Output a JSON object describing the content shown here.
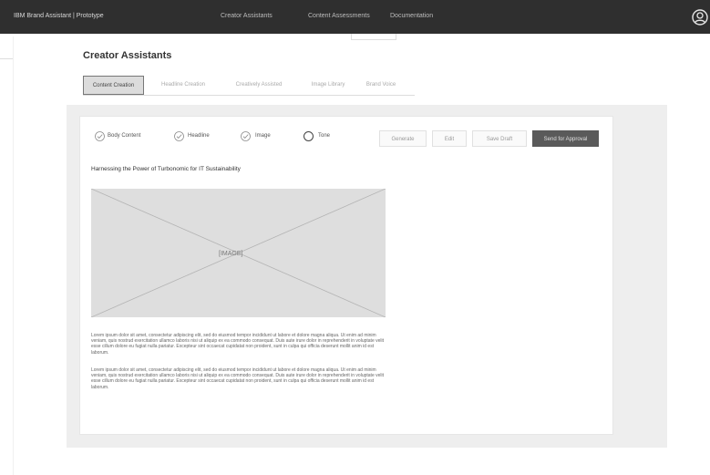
{
  "topbar": {
    "brand": "IBM Brand Assistant  |  Prototype",
    "nav": [
      "Creator Assistants",
      "Content Assessments",
      "Documentation"
    ]
  },
  "page_title": "Creator Assistants",
  "tabs": [
    "Content Creation",
    "Headline Creation",
    "Creatively Assisted",
    "Image Library",
    "Brand Voice"
  ],
  "toolbar": {
    "options": [
      "Body Content",
      "Headline",
      "Image",
      "Tone"
    ],
    "buttons": [
      "Generate",
      "Edit",
      "Save Draft",
      "Send for Approval"
    ]
  },
  "article": {
    "title": "Harnessing the Power of Turbonomic for IT Sustainability",
    "image_label": "[IMAGE]",
    "paragraphs": [
      "Lorem ipsum dolor sit amet, consectetur adipiscing elit, sed do eiusmod tempor incididunt ut labore et dolore magna aliqua. Ut enim ad minim veniam, quis nostrud exercitation ullamco laboris nisi ut aliquip ex ea commodo consequat. Duis aute irure dolor in reprehenderit in voluptate velit esse cillum dolore eu fugiat nulla pariatur. Excepteur sint occaecat cupidatat non proident, sunt in culpa qui officia deserunt mollit anim id est laborum.",
      "Lorem ipsum dolor sit amet, consectetur adipiscing elit, sed do eiusmod tempor incididunt ut labore et dolore magna aliqua. Ut enim ad minim veniam, quis nostrud exercitation ullamco laboris nisi ut aliquip ex ea commodo consequat. Duis aute irure dolor in reprehenderit in voluptate velit esse cillum dolore eu fugiat nulla pariatur. Excepteur sint occaecat cupidatat non proident, sunt in culpa qui officia deserunt mollit anim id est laborum."
    ]
  },
  "icons": {
    "user": "user-avatar-icon",
    "check": "check-circle-icon",
    "empty": "empty-circle-icon"
  }
}
